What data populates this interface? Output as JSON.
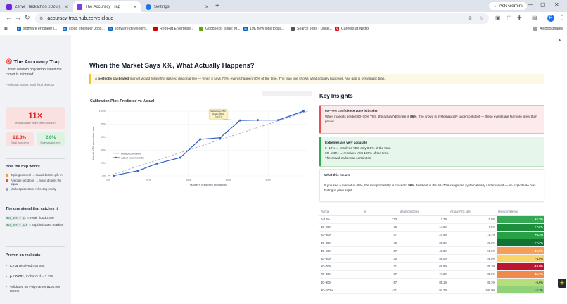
{
  "browser": {
    "tabs": [
      {
        "label": "Zerve Hackathon 2026 | Zerve...",
        "active": false,
        "color": "#6d28d9"
      },
      {
        "label": "The Accuracy Trap",
        "active": true,
        "color": "#7c3aed"
      },
      {
        "label": "Settings",
        "active": false,
        "color": "#1a73e8"
      }
    ],
    "ask_gemini": "Ask Gemini",
    "url": "accuracy-trap.hub.zerve.cloud",
    "profile_initial": "R",
    "bookmarks": [
      {
        "label": "software engineer j...",
        "icon": "linkedin-icon",
        "color": "#0a66c2"
      },
      {
        "label": "cloud engineer Jobs...",
        "icon": "linkedin-icon",
        "color": "#0a66c2"
      },
      {
        "label": "software developm...",
        "icon": "linkedin-icon",
        "color": "#0a66c2"
      },
      {
        "label": "Red Hat Enterprise...",
        "icon": "redhat-icon",
        "color": "#cc0000"
      },
      {
        "label": "Good First Issue: M...",
        "icon": "gfi-icon",
        "color": "#65a30d"
      },
      {
        "label": "19K new jobs today...",
        "icon": "linkedin-icon",
        "color": "#0a66c2"
      },
      {
        "label": "Search Jobs - Unite...",
        "icon": "apple-icon",
        "color": "#555555"
      },
      {
        "label": "Careers at Netflix",
        "icon": "netflix-icon",
        "color": "#e50914"
      }
    ],
    "all_bookmarks": "All Bookmarks"
  },
  "sidebar": {
    "title": "The Accuracy Trap",
    "tagline": "Crowd wisdom only works when the crowd is informed.",
    "small_label": "Prediction market retail flood detector",
    "big_stat": {
      "value": "11×",
      "caption": "less accurate when retail floods in"
    },
    "mini_stats": [
      {
        "value": "22.3%",
        "caption": "Retail flood error",
        "color": "#dc2626",
        "bg": "#fbe0e0"
      },
      {
        "value": "2.0%",
        "caption": "Sophisticated error",
        "color": "#16a34a",
        "bg": "#dff3e3"
      }
    ],
    "how_title": "How the trap works",
    "how_items": [
      {
        "text": "Topic goes viral → casual bettors pile in",
        "color": "#f59e0b"
      },
      {
        "text": "Average bet drops → noise drowns the signal",
        "color": "#ef4444"
      },
      {
        "text": "Market price stops reflecting reality",
        "color": "#9ca3af"
      }
    ],
    "signal_title": "The one signal that catches it",
    "signal_lines": [
      {
        "code": "avg_bet < $X",
        "text": "= retail flood zone"
      },
      {
        "code": "avg_bet > $XX",
        "text": "= sophisticated market"
      }
    ],
    "proven_title": "Proven on real data",
    "proven_items": [
      {
        "strong": "4,714",
        "text": " resolved markets"
      },
      {
        "strong": "p < 0.001",
        "text": ", Cohen's d = 1.256"
      },
      {
        "strong": "",
        "text": "Validated on Polymarket $116.9M USDC"
      }
    ]
  },
  "main": {
    "heading": "When the Market Says X%, What Actually Happens?",
    "note_prefix": "A ",
    "note_bold": "perfectly calibrated",
    "note_rest": " market would follow the dashed diagonal line — when it says 70%, events happen 70% of the time. The blue line shows what actually happens. Any gap is systematic bias.",
    "chart_title": "Calibration Plot: Predicted vs Actual"
  },
  "chart_data": {
    "type": "line",
    "title": "Calibration Plot: Predicted vs Actual",
    "xlabel": "Market's predicted probability",
    "ylabel": "Actual YES resolution rate",
    "xlim": [
      0,
      1
    ],
    "ylim": [
      0,
      1
    ],
    "x_ticks": [
      "0%",
      "20%",
      "40%",
      "60%",
      "80%"
    ],
    "y_ticks": [
      "0%",
      "20%",
      "40%",
      "60%",
      "80%",
      "100%"
    ],
    "legend": [
      "Perfect calibration",
      "Actual outcome rate"
    ],
    "legend_position": "top-left",
    "series": [
      {
        "name": "Actual outcome rate",
        "color": "#2f5ec4",
        "x": [
          0.027,
          0.148,
          0.244,
          0.36,
          0.46,
          0.56,
          0.659,
          0.748,
          0.851,
          0.977
        ],
        "y": [
          0.005,
          0.079,
          0.191,
          0.283,
          0.566,
          0.59,
          0.857,
          0.863,
          0.863,
          1.0
        ]
      },
      {
        "name": "Perfect calibration",
        "color": "#9ca3af",
        "x": [
          0,
          1
        ],
        "y": [
          0,
          1
        ]
      }
    ],
    "annotation": {
      "lines": [
        "Market says 65%",
        "Reality: 86%",
        "Gap: 21"
      ],
      "x": 0.659,
      "y": 0.857
    }
  },
  "insights": {
    "title": "Key Insights",
    "red": {
      "title": "60–70% confidence zone is broken",
      "body_prefix": "When markets predict 60–70% YES, the actual YES rate is ",
      "body_bold": "86%",
      "body_rest": ". The crowd is systematically underconfident — these events are far more likely than priced."
    },
    "green": {
      "title": "Extremes are very accurate",
      "lines": [
        "0–10% → resolves YES only 0.5% of the time.",
        "90–100% → resolves YES 100% of the time.",
        "The crowd nails near-certainties."
      ]
    },
    "white": {
      "title": "What this means",
      "body_prefix": "If you see a market at 65%, the real probability is closer to ",
      "body_bold": "86%",
      "body_rest": ". Markets in the 60–70% range are systematically undervalued — an exploitable bias hiding in plain sight."
    }
  },
  "table": {
    "headers": [
      "Range",
      "n",
      "Mean predicted",
      "Actual YES rate",
      "Overconfidence"
    ],
    "rows": [
      {
        "range": "0–10%",
        "n": "733",
        "pred": "2.7%",
        "actual": "0.5%",
        "over": "+2.2%",
        "color": "#34a853"
      },
      {
        "range": "10–20%",
        "n": "76",
        "pred": "14.8%",
        "actual": "7.9%",
        "over": "+7.0%",
        "color": "#1e8e3e"
      },
      {
        "range": "20–30%",
        "n": "47",
        "pred": "24.4%",
        "actual": "19.1%",
        "over": "+5.3%",
        "color": "#27a046"
      },
      {
        "range": "30–40%",
        "n": "46",
        "pred": "36.0%",
        "actual": "28.3%",
        "over": "+7.7%",
        "color": "#137333"
      },
      {
        "range": "40–50%",
        "n": "37",
        "pred": "46.0%",
        "actual": "56.6%",
        "over": "-10.5%",
        "color": "#f59e57"
      },
      {
        "range": "50–60%",
        "n": "30",
        "pred": "56.0%",
        "actual": "59.0%",
        "over": "-3.0%",
        "color": "#f7d56a"
      },
      {
        "range": "60–70%",
        "n": "21",
        "pred": "65.9%",
        "actual": "85.7%",
        "over": "-19.8%",
        "color": "#c0152f"
      },
      {
        "range": "70–80%",
        "n": "37",
        "pred": "74.8%",
        "actual": "86.5%",
        "over": "-11.7%",
        "color": "#f08a4b"
      },
      {
        "range": "80–90%",
        "n": "57",
        "pred": "85.1%",
        "actual": "86.3%",
        "over": "-0.9%",
        "color": "#b5dd7a"
      },
      {
        "range": "90–100%",
        "n": "431",
        "pred": "97.7%",
        "actual": "100.0%",
        "over": "-2.3%",
        "color": "#8fd27a"
      }
    ]
  }
}
